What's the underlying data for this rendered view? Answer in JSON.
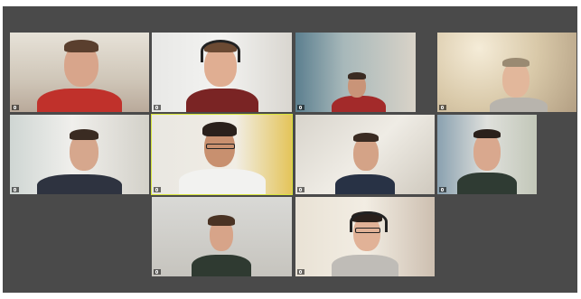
{
  "meeting": {
    "participants": [
      {
        "name": "",
        "mic_icon": "mic-icon"
      },
      {
        "name": "",
        "mic_icon": "mic-icon"
      },
      {
        "name": "",
        "mic_icon": "mic-icon"
      },
      {
        "name": "",
        "mic_icon": "mic-icon"
      },
      {
        "name": "",
        "mic_icon": "mic-icon"
      },
      {
        "name": "",
        "mic_icon": "mic-icon",
        "active_speaker": true
      },
      {
        "name": "",
        "mic_icon": "mic-icon"
      },
      {
        "name": "",
        "mic_icon": "mic-icon"
      },
      {
        "name": "",
        "mic_icon": "mic-icon"
      },
      {
        "name": "",
        "mic_icon": "mic-icon"
      }
    ]
  },
  "colors": {
    "stage_background": "#4a4a4a",
    "active_speaker_border": "#d6e33a",
    "name_label_text": "#ffffff"
  }
}
